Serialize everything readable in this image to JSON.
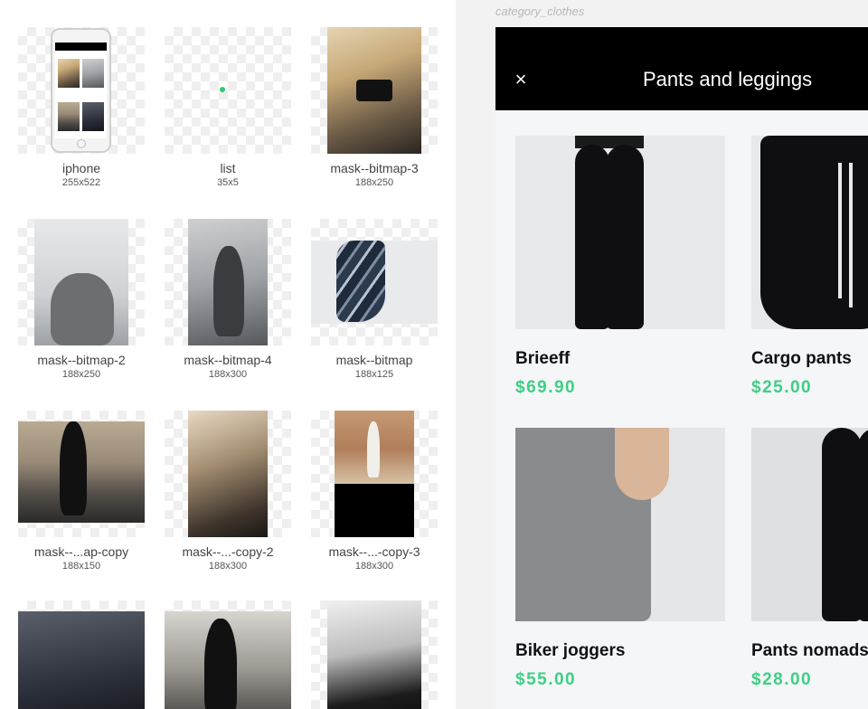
{
  "library": {
    "assets": [
      {
        "name": "iphone",
        "size": "255x522"
      },
      {
        "name": "list",
        "size": "35x5"
      },
      {
        "name": "mask--bitmap-3",
        "size": "188x250"
      },
      {
        "name": "mask--bitmap-2",
        "size": "188x250"
      },
      {
        "name": "mask--bitmap-4",
        "size": "188x300"
      },
      {
        "name": "mask--bitmap",
        "size": "188x125"
      },
      {
        "name": "mask--...ap-copy",
        "size": "188x150"
      },
      {
        "name": "mask--...-copy-2",
        "size": "188x300"
      },
      {
        "name": "mask--...-copy-3",
        "size": "188x300"
      },
      {
        "name": "",
        "size": ""
      },
      {
        "name": "",
        "size": ""
      },
      {
        "name": "",
        "size": ""
      }
    ]
  },
  "artboard": {
    "label": "category_clothes",
    "header": {
      "close_icon": "×",
      "title": "Pants and leggings"
    },
    "products": [
      {
        "name": "Brieeff",
        "price": "$69.90"
      },
      {
        "name": "Cargo pants",
        "price": "$25.00"
      },
      {
        "name": "Biker joggers",
        "price": "$55.00"
      },
      {
        "name": "Pants nomads",
        "price": "$28.00"
      }
    ]
  },
  "colors": {
    "price_green": "#3ecf85",
    "header_black": "#000000",
    "list_dot": "#2ecc71"
  }
}
